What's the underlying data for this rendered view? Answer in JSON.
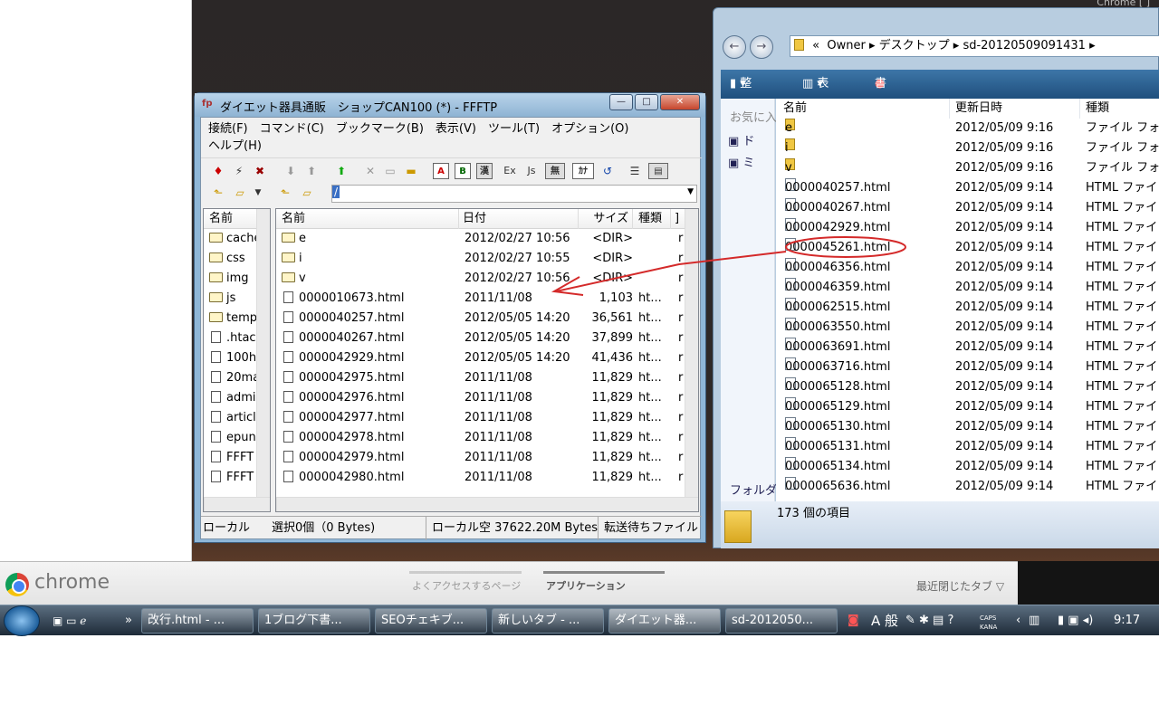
{
  "ffftp": {
    "title": "ダイエット器具通販　ショップCAN100 (*) - FFFTP",
    "menu": [
      "接続(F)",
      "コマンド(C)",
      "ブックマーク(B)",
      "表示(V)",
      "ツール(T)",
      "オプション(O)",
      "ヘルプ(H)"
    ],
    "remote_path": "/",
    "local_header": "名前",
    "local_items": [
      {
        "name": "cache",
        "type": "dir"
      },
      {
        "name": "css",
        "type": "dir"
      },
      {
        "name": "img",
        "type": "dir"
      },
      {
        "name": "js",
        "type": "dir"
      },
      {
        "name": "temp",
        "type": "dir"
      },
      {
        "name": ".htac",
        "type": "file"
      },
      {
        "name": "100h",
        "type": "file"
      },
      {
        "name": "20ma",
        "type": "file"
      },
      {
        "name": "admi",
        "type": "file"
      },
      {
        "name": "articl",
        "type": "file"
      },
      {
        "name": "epun",
        "type": "file"
      },
      {
        "name": "FFFT",
        "type": "file"
      },
      {
        "name": "FFFT",
        "type": "file"
      }
    ],
    "remote_headers": {
      "name": "名前",
      "date": "日付",
      "size": "サイズ",
      "type": "種類",
      "attr": "]"
    },
    "remote_items": [
      {
        "name": "e",
        "date": "2012/02/27 10:56",
        "size": "<DIR>",
        "type": "",
        "attr": "r",
        "dir": true
      },
      {
        "name": "i",
        "date": "2012/02/27 10:55",
        "size": "<DIR>",
        "type": "",
        "attr": "r",
        "dir": true
      },
      {
        "name": "v",
        "date": "2012/02/27 10:56",
        "size": "<DIR>",
        "type": "",
        "attr": "r",
        "dir": true
      },
      {
        "name": "0000010673.html",
        "date": "2011/11/08",
        "size": "1,103",
        "type": "ht...",
        "attr": "r",
        "dir": false
      },
      {
        "name": "0000040257.html",
        "date": "2012/05/05 14:20",
        "size": "36,561",
        "type": "ht...",
        "attr": "r",
        "dir": false
      },
      {
        "name": "0000040267.html",
        "date": "2012/05/05 14:20",
        "size": "37,899",
        "type": "ht...",
        "attr": "r",
        "dir": false
      },
      {
        "name": "0000042929.html",
        "date": "2012/05/05 14:20",
        "size": "41,436",
        "type": "ht...",
        "attr": "r",
        "dir": false
      },
      {
        "name": "0000042975.html",
        "date": "2011/11/08",
        "size": "11,829",
        "type": "ht...",
        "attr": "r",
        "dir": false
      },
      {
        "name": "0000042976.html",
        "date": "2011/11/08",
        "size": "11,829",
        "type": "ht...",
        "attr": "r",
        "dir": false
      },
      {
        "name": "0000042977.html",
        "date": "2011/11/08",
        "size": "11,829",
        "type": "ht...",
        "attr": "r",
        "dir": false
      },
      {
        "name": "0000042978.html",
        "date": "2011/11/08",
        "size": "11,829",
        "type": "ht...",
        "attr": "r",
        "dir": false
      },
      {
        "name": "0000042979.html",
        "date": "2011/11/08",
        "size": "11,829",
        "type": "ht...",
        "attr": "r",
        "dir": false
      },
      {
        "name": "0000042980.html",
        "date": "2011/11/08",
        "size": "11,829",
        "type": "ht...",
        "attr": "r",
        "dir": false
      }
    ],
    "status": {
      "local": "ローカル",
      "selected": "選択0個（0 Bytes)",
      "free": "ローカル空 37622.20M Bytes",
      "queue": "転送待ちファイル"
    },
    "toolbar_labels": {
      "ascii": "A",
      "binary": "B",
      "auto": "漢",
      "ex": "Ex",
      "js": "Js",
      "nokana": "無",
      "kana": "ｶﾅ"
    }
  },
  "explorer": {
    "window_caption": "Chrome [ ]",
    "breadcrumb": [
      "«",
      "Owner",
      "デスクトップ",
      "sd-20120509091431"
    ],
    "commands": {
      "organize": "整理",
      "view": "表示",
      "burn": "書き込む"
    },
    "nav": {
      "favorites": "お気に入",
      "item1": "ド",
      "item2": "ミ",
      "folders": "フォルダ"
    },
    "headers": {
      "name": "名前",
      "date": "更新日時",
      "type": "種類"
    },
    "items": [
      {
        "name": "e",
        "date": "2012/05/09 9:16",
        "type": "ファイル フォ",
        "dir": true
      },
      {
        "name": "i",
        "date": "2012/05/09 9:16",
        "type": "ファイル フォ",
        "dir": true
      },
      {
        "name": "v",
        "date": "2012/05/09 9:16",
        "type": "ファイル フォ",
        "dir": true
      },
      {
        "name": "0000040257.html",
        "date": "2012/05/09 9:14",
        "type": "HTML ファイ",
        "dir": false
      },
      {
        "name": "0000040267.html",
        "date": "2012/05/09 9:14",
        "type": "HTML ファイ",
        "dir": false
      },
      {
        "name": "0000042929.html",
        "date": "2012/05/09 9:14",
        "type": "HTML ファイ",
        "dir": false
      },
      {
        "name": "0000045261.html",
        "date": "2012/05/09 9:14",
        "type": "HTML ファイ",
        "dir": false
      },
      {
        "name": "0000046356.html",
        "date": "2012/05/09 9:14",
        "type": "HTML ファイ",
        "dir": false
      },
      {
        "name": "0000046359.html",
        "date": "2012/05/09 9:14",
        "type": "HTML ファイ",
        "dir": false
      },
      {
        "name": "0000062515.html",
        "date": "2012/05/09 9:14",
        "type": "HTML ファイ",
        "dir": false
      },
      {
        "name": "0000063550.html",
        "date": "2012/05/09 9:14",
        "type": "HTML ファイ",
        "dir": false
      },
      {
        "name": "0000063691.html",
        "date": "2012/05/09 9:14",
        "type": "HTML ファイ",
        "dir": false
      },
      {
        "name": "0000063716.html",
        "date": "2012/05/09 9:14",
        "type": "HTML ファイ",
        "dir": false
      },
      {
        "name": "0000065128.html",
        "date": "2012/05/09 9:14",
        "type": "HTML ファイ",
        "dir": false
      },
      {
        "name": "0000065129.html",
        "date": "2012/05/09 9:14",
        "type": "HTML ファイ",
        "dir": false
      },
      {
        "name": "0000065130.html",
        "date": "2012/05/09 9:14",
        "type": "HTML ファイ",
        "dir": false
      },
      {
        "name": "0000065131.html",
        "date": "2012/05/09 9:14",
        "type": "HTML ファイ",
        "dir": false
      },
      {
        "name": "0000065134.html",
        "date": "2012/05/09 9:14",
        "type": "HTML ファイ",
        "dir": false
      },
      {
        "name": "0000065636.html",
        "date": "2012/05/09 9:14",
        "type": "HTML ファイ",
        "dir": false
      }
    ],
    "footer_count": "173 個の項目"
  },
  "chrome": {
    "logo_text": "chrome",
    "tab_frequent": "よくアクセスするページ",
    "tab_apps": "アプリケーション",
    "recent": "最近閉じたタブ ▽"
  },
  "taskbar": {
    "buttons": [
      "改行.html - ...",
      "1ブログ下書...",
      "SEOチェキブ...",
      "新しいタブ - ...",
      "ダイエット器...",
      "sd-2012050..."
    ],
    "ime": "A 般",
    "caps": "CAPS",
    "kana": "KANA",
    "clock": "9:17"
  },
  "colors": {
    "highlight_red": "#d42a2a",
    "explorer_cmd": "#2a5f91"
  }
}
